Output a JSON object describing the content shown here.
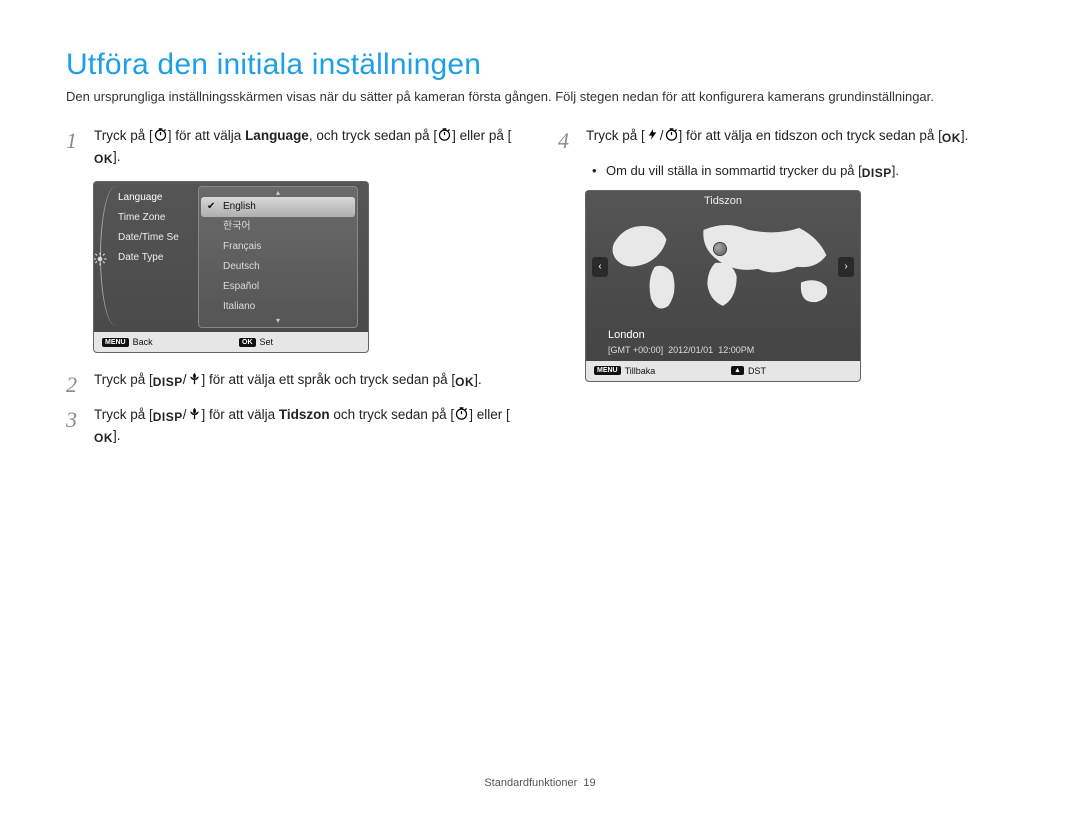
{
  "title": "Utföra den initiala inställningen",
  "intro": "Den ursprungliga inställningsskärmen visas när du sätter på kameran första gången. Följ stegen nedan för att konfigurera kamerans grundinställningar.",
  "icons": {
    "timer": "timer-icon",
    "ok": "OK",
    "disp": "DISP",
    "flower": "macro-icon",
    "flash": "flash-icon",
    "menu": "MENU",
    "up_triangle": "▲"
  },
  "steps": {
    "s1": {
      "num": "1",
      "a": "Tryck på [",
      "b": "] för att välja ",
      "bold": "Language",
      "c": ", och tryck sedan på [",
      "d": "] eller på [",
      "e": "]."
    },
    "s2": {
      "num": "2",
      "a": "Tryck på [",
      "b": "/",
      "c": "] för att välja ett språk och tryck sedan på [",
      "d": "]."
    },
    "s3": {
      "num": "3",
      "a": "Tryck på [",
      "b": "/",
      "c": "] för att välja ",
      "bold": "Tidszon",
      "d": " och tryck sedan på [",
      "e": "] eller [",
      "f": "]."
    },
    "s4": {
      "num": "4",
      "a": "Tryck på [",
      "b": "/",
      "c": "] för att välja en tidszon och tryck sedan på  [",
      "d": "]."
    },
    "s4_sub": {
      "a": "Om du vill ställa in sommartid trycker du på [",
      "b": "]."
    }
  },
  "lang_screen": {
    "side": [
      "Language",
      "Time Zone",
      "Date/Time Se",
      "Date Type"
    ],
    "options": [
      "English",
      "한국어",
      "Français",
      "Deutsch",
      "Español",
      "Italiano"
    ],
    "footer_left_key": "MENU",
    "footer_left": "Back",
    "footer_right_key": "OK",
    "footer_right": "Set"
  },
  "tz_screen": {
    "title": "Tidszon",
    "city": "London",
    "gmt": "[GMT +00:00]",
    "date": "2012/01/01",
    "time": "12:00PM",
    "footer_left_key": "MENU",
    "footer_left": "Tillbaka",
    "footer_right_tri": "▲",
    "footer_right": "DST"
  },
  "footer": {
    "section": "Standardfunktioner",
    "page": "19"
  }
}
